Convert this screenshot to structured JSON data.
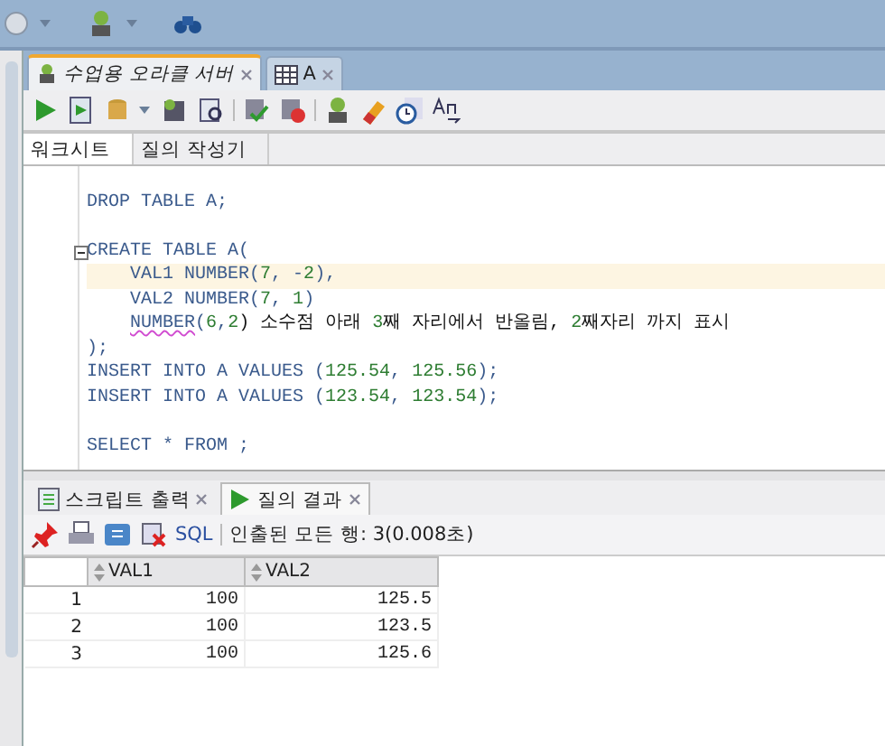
{
  "editor_tabs": [
    {
      "label": "수업용 오라클 서버",
      "kind": "connection",
      "selected": true
    },
    {
      "label": "A",
      "kind": "table",
      "selected": false
    }
  ],
  "sub_tabs": [
    {
      "label": "워크시트",
      "selected": true
    },
    {
      "label": "질의 작성기",
      "selected": false
    }
  ],
  "code_lines": [
    {
      "highlighted": false,
      "foldable": false
    },
    {
      "highlighted": false,
      "foldable": false,
      "segments": [
        {
          "text": "DROP TABLE A;",
          "kind": "keyword"
        }
      ]
    },
    {
      "highlighted": false,
      "foldable": false
    },
    {
      "highlighted": false,
      "foldable": true,
      "segments": [
        {
          "text": "CREATE TABLE A(",
          "kind": "keyword"
        }
      ]
    },
    {
      "highlighted": true,
      "foldable": false,
      "indented": true,
      "segments": [
        {
          "text": "VAL1 NUMBER(",
          "kind": "keyword"
        },
        {
          "text": "7",
          "kind": "number"
        },
        {
          "text": ", -",
          "kind": "keyword"
        },
        {
          "text": "2",
          "kind": "number"
        },
        {
          "text": "),",
          "kind": "keyword"
        }
      ]
    },
    {
      "highlighted": false,
      "foldable": false,
      "indented": true,
      "segments": [
        {
          "text": "VAL2 NUMBER(",
          "kind": "keyword"
        },
        {
          "text": "7",
          "kind": "number"
        },
        {
          "text": ", ",
          "kind": "keyword"
        },
        {
          "text": "1",
          "kind": "number"
        },
        {
          "text": ")",
          "kind": "keyword"
        }
      ]
    },
    {
      "highlighted": false,
      "foldable": false,
      "indented": true,
      "segments": [
        {
          "text": "NUMBER",
          "kind": "error"
        },
        {
          "text": "(",
          "kind": "keyword"
        },
        {
          "text": "6",
          "kind": "number"
        },
        {
          "text": ",",
          "kind": "keyword"
        },
        {
          "text": "2",
          "kind": "number"
        },
        {
          "text": ") 소수점 아래 ",
          "kind": "text"
        },
        {
          "text": "3",
          "kind": "number"
        },
        {
          "text": "째 자리에서 반올림, ",
          "kind": "text"
        },
        {
          "text": "2",
          "kind": "number"
        },
        {
          "text": "째자리 까지 표시",
          "kind": "text"
        }
      ]
    },
    {
      "highlighted": false,
      "foldable": false,
      "segments": [
        {
          "text": ");",
          "kind": "keyword"
        }
      ]
    },
    {
      "highlighted": false,
      "foldable": false,
      "segments": [
        {
          "text": "INSERT INTO A VALUES (",
          "kind": "keyword"
        },
        {
          "text": "125.54",
          "kind": "number"
        },
        {
          "text": ", ",
          "kind": "keyword"
        },
        {
          "text": "125.56",
          "kind": "number"
        },
        {
          "text": ");",
          "kind": "keyword"
        }
      ]
    },
    {
      "highlighted": false,
      "foldable": false,
      "segments": [
        {
          "text": "INSERT INTO A VALUES (",
          "kind": "keyword"
        },
        {
          "text": "123.54",
          "kind": "number"
        },
        {
          "text": ", ",
          "kind": "keyword"
        },
        {
          "text": "123.54",
          "kind": "number"
        },
        {
          "text": ");",
          "kind": "keyword"
        }
      ]
    },
    {
      "highlighted": false,
      "foldable": false
    },
    {
      "highlighted": false,
      "foldable": false,
      "segments": [
        {
          "text": "SELECT * FROM ;",
          "kind": "keyword"
        }
      ]
    }
  ],
  "result_tabs": [
    {
      "label": "스크립트 출력",
      "kind": "script",
      "selected": false
    },
    {
      "label": "질의 결과",
      "kind": "query",
      "selected": true
    }
  ],
  "result_toolbar": {
    "sql_link": "SQL",
    "status": "인출된 모든 행: 3(0.008초)"
  },
  "table": {
    "columns": [
      "VAL1",
      "VAL2"
    ],
    "rows": [
      {
        "number": "1",
        "cells": [
          "100",
          "125.5"
        ]
      },
      {
        "number": "2",
        "cells": [
          "100",
          "123.5"
        ]
      },
      {
        "number": "3",
        "cells": [
          "100",
          "125.6"
        ]
      }
    ]
  }
}
